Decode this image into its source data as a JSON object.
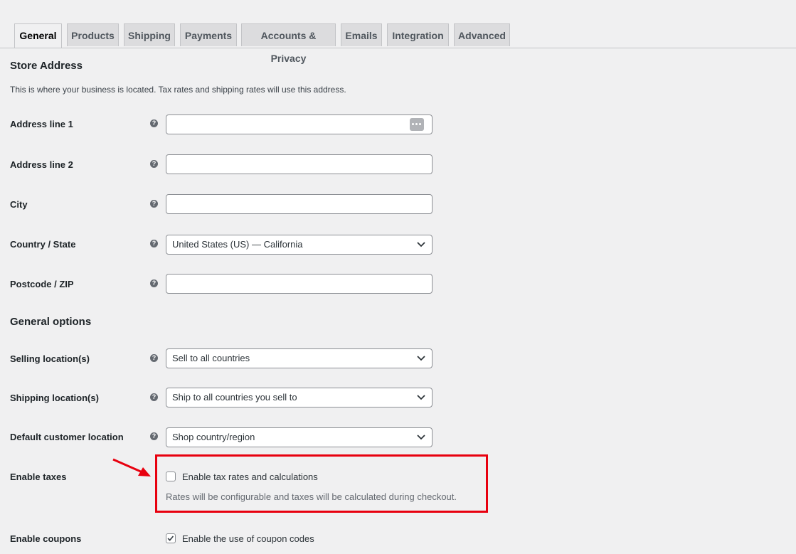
{
  "tabs": [
    {
      "label": "General",
      "active": true
    },
    {
      "label": "Products"
    },
    {
      "label": "Shipping"
    },
    {
      "label": "Payments"
    },
    {
      "label": "Accounts & Privacy"
    },
    {
      "label": "Emails"
    },
    {
      "label": "Integration"
    },
    {
      "label": "Advanced"
    }
  ],
  "store_address": {
    "heading": "Store Address",
    "description": "This is where your business is located. Tax rates and shipping rates will use this address.",
    "fields": {
      "address1": {
        "label": "Address line 1",
        "value": ""
      },
      "address2": {
        "label": "Address line 2",
        "value": ""
      },
      "city": {
        "label": "City",
        "value": ""
      },
      "country": {
        "label": "Country / State",
        "value": "United States (US) — California"
      },
      "postcode": {
        "label": "Postcode / ZIP",
        "value": ""
      }
    }
  },
  "general_options": {
    "heading": "General options",
    "selling": {
      "label": "Selling location(s)",
      "value": "Sell to all countries"
    },
    "shipping": {
      "label": "Shipping location(s)",
      "value": "Ship to all countries you sell to"
    },
    "customer": {
      "label": "Default customer location",
      "value": "Shop country/region"
    },
    "taxes": {
      "label": "Enable taxes",
      "checkbox_label": "Enable tax rates and calculations",
      "checked": false,
      "help": "Rates will be configurable and taxes will be calculated during checkout."
    },
    "coupons": {
      "label": "Enable coupons",
      "checkbox_label": "Enable the use of coupon codes",
      "checked": true
    }
  },
  "help_glyph": "?",
  "colors": {
    "annotation": "#e8000f",
    "background": "#f0f0f1"
  },
  "icons": {
    "help": "help-icon",
    "dropdown": "chevron-down-icon",
    "password": "password-manager-icon",
    "annotation": "arrow-annotation-icon"
  }
}
